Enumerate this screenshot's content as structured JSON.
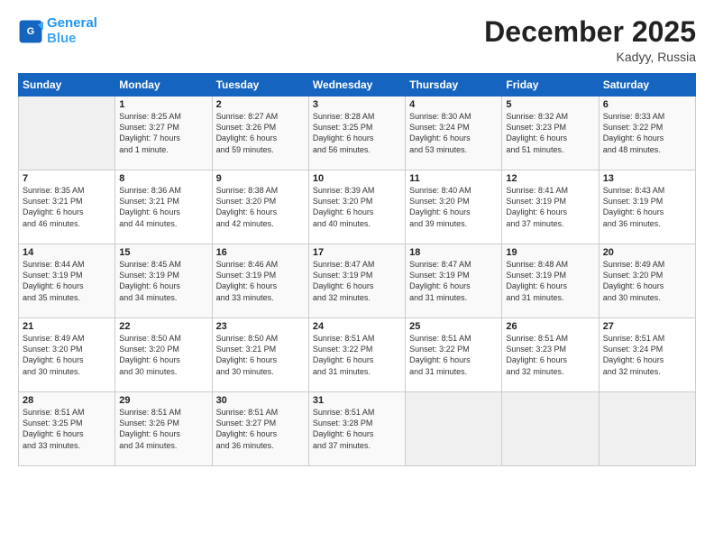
{
  "logo": {
    "line1": "General",
    "line2": "Blue"
  },
  "title": "December 2025",
  "location": "Kadyy, Russia",
  "days_header": [
    "Sunday",
    "Monday",
    "Tuesday",
    "Wednesday",
    "Thursday",
    "Friday",
    "Saturday"
  ],
  "weeks": [
    [
      {
        "day": "",
        "info": ""
      },
      {
        "day": "1",
        "info": "Sunrise: 8:25 AM\nSunset: 3:27 PM\nDaylight: 7 hours\nand 1 minute."
      },
      {
        "day": "2",
        "info": "Sunrise: 8:27 AM\nSunset: 3:26 PM\nDaylight: 6 hours\nand 59 minutes."
      },
      {
        "day": "3",
        "info": "Sunrise: 8:28 AM\nSunset: 3:25 PM\nDaylight: 6 hours\nand 56 minutes."
      },
      {
        "day": "4",
        "info": "Sunrise: 8:30 AM\nSunset: 3:24 PM\nDaylight: 6 hours\nand 53 minutes."
      },
      {
        "day": "5",
        "info": "Sunrise: 8:32 AM\nSunset: 3:23 PM\nDaylight: 6 hours\nand 51 minutes."
      },
      {
        "day": "6",
        "info": "Sunrise: 8:33 AM\nSunset: 3:22 PM\nDaylight: 6 hours\nand 48 minutes."
      }
    ],
    [
      {
        "day": "7",
        "info": "Sunrise: 8:35 AM\nSunset: 3:21 PM\nDaylight: 6 hours\nand 46 minutes."
      },
      {
        "day": "8",
        "info": "Sunrise: 8:36 AM\nSunset: 3:21 PM\nDaylight: 6 hours\nand 44 minutes."
      },
      {
        "day": "9",
        "info": "Sunrise: 8:38 AM\nSunset: 3:20 PM\nDaylight: 6 hours\nand 42 minutes."
      },
      {
        "day": "10",
        "info": "Sunrise: 8:39 AM\nSunset: 3:20 PM\nDaylight: 6 hours\nand 40 minutes."
      },
      {
        "day": "11",
        "info": "Sunrise: 8:40 AM\nSunset: 3:20 PM\nDaylight: 6 hours\nand 39 minutes."
      },
      {
        "day": "12",
        "info": "Sunrise: 8:41 AM\nSunset: 3:19 PM\nDaylight: 6 hours\nand 37 minutes."
      },
      {
        "day": "13",
        "info": "Sunrise: 8:43 AM\nSunset: 3:19 PM\nDaylight: 6 hours\nand 36 minutes."
      }
    ],
    [
      {
        "day": "14",
        "info": "Sunrise: 8:44 AM\nSunset: 3:19 PM\nDaylight: 6 hours\nand 35 minutes."
      },
      {
        "day": "15",
        "info": "Sunrise: 8:45 AM\nSunset: 3:19 PM\nDaylight: 6 hours\nand 34 minutes."
      },
      {
        "day": "16",
        "info": "Sunrise: 8:46 AM\nSunset: 3:19 PM\nDaylight: 6 hours\nand 33 minutes."
      },
      {
        "day": "17",
        "info": "Sunrise: 8:47 AM\nSunset: 3:19 PM\nDaylight: 6 hours\nand 32 minutes."
      },
      {
        "day": "18",
        "info": "Sunrise: 8:47 AM\nSunset: 3:19 PM\nDaylight: 6 hours\nand 31 minutes."
      },
      {
        "day": "19",
        "info": "Sunrise: 8:48 AM\nSunset: 3:19 PM\nDaylight: 6 hours\nand 31 minutes."
      },
      {
        "day": "20",
        "info": "Sunrise: 8:49 AM\nSunset: 3:20 PM\nDaylight: 6 hours\nand 30 minutes."
      }
    ],
    [
      {
        "day": "21",
        "info": "Sunrise: 8:49 AM\nSunset: 3:20 PM\nDaylight: 6 hours\nand 30 minutes."
      },
      {
        "day": "22",
        "info": "Sunrise: 8:50 AM\nSunset: 3:20 PM\nDaylight: 6 hours\nand 30 minutes."
      },
      {
        "day": "23",
        "info": "Sunrise: 8:50 AM\nSunset: 3:21 PM\nDaylight: 6 hours\nand 30 minutes."
      },
      {
        "day": "24",
        "info": "Sunrise: 8:51 AM\nSunset: 3:22 PM\nDaylight: 6 hours\nand 31 minutes."
      },
      {
        "day": "25",
        "info": "Sunrise: 8:51 AM\nSunset: 3:22 PM\nDaylight: 6 hours\nand 31 minutes."
      },
      {
        "day": "26",
        "info": "Sunrise: 8:51 AM\nSunset: 3:23 PM\nDaylight: 6 hours\nand 32 minutes."
      },
      {
        "day": "27",
        "info": "Sunrise: 8:51 AM\nSunset: 3:24 PM\nDaylight: 6 hours\nand 32 minutes."
      }
    ],
    [
      {
        "day": "28",
        "info": "Sunrise: 8:51 AM\nSunset: 3:25 PM\nDaylight: 6 hours\nand 33 minutes."
      },
      {
        "day": "29",
        "info": "Sunrise: 8:51 AM\nSunset: 3:26 PM\nDaylight: 6 hours\nand 34 minutes."
      },
      {
        "day": "30",
        "info": "Sunrise: 8:51 AM\nSunset: 3:27 PM\nDaylight: 6 hours\nand 36 minutes."
      },
      {
        "day": "31",
        "info": "Sunrise: 8:51 AM\nSunset: 3:28 PM\nDaylight: 6 hours\nand 37 minutes."
      },
      {
        "day": "",
        "info": ""
      },
      {
        "day": "",
        "info": ""
      },
      {
        "day": "",
        "info": ""
      }
    ]
  ]
}
